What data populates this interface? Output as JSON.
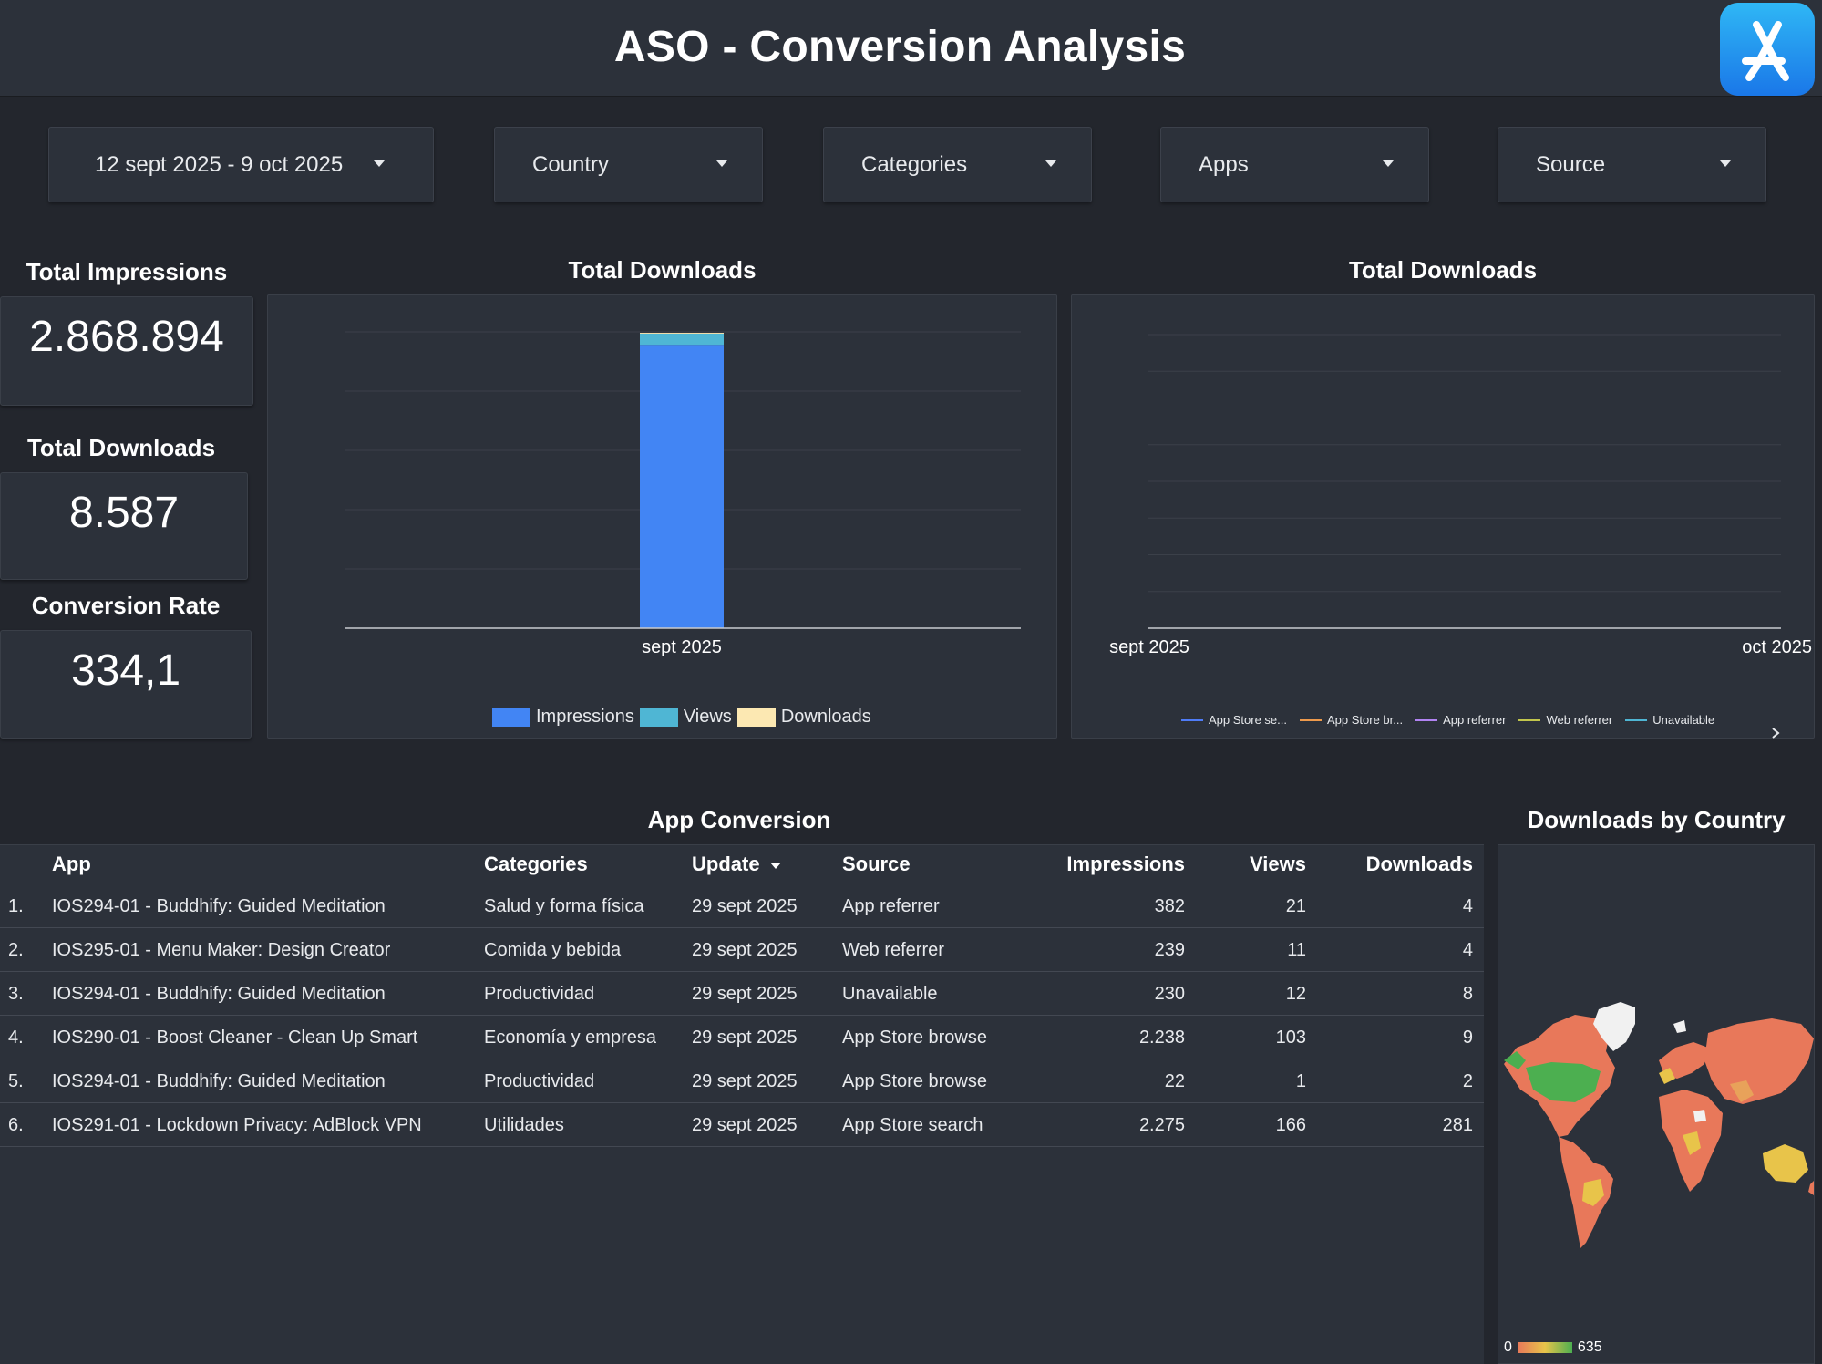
{
  "header": {
    "title": "ASO - Conversion Analysis",
    "logo_icon": "app-store-icon"
  },
  "filters": [
    {
      "label": "12 sept 2025 - 9 oct 2025"
    },
    {
      "label": "Country"
    },
    {
      "label": "Categories"
    },
    {
      "label": "Apps"
    },
    {
      "label": "Source"
    }
  ],
  "kpis": {
    "impressions": {
      "title": "Total Impressions",
      "value": "2.868.894"
    },
    "downloads": {
      "title": "Total Downloads",
      "value": "8.587"
    },
    "conversion": {
      "title": "Conversion Rate",
      "value": "334,1"
    }
  },
  "chart_data": [
    {
      "type": "bar",
      "stacked": true,
      "title": "Total Downloads",
      "categories": [
        "sept 2025"
      ],
      "series": [
        {
          "name": "Impressions",
          "values": [
            2868894
          ],
          "color": "#4285f4"
        },
        {
          "name": "Views",
          "values": [
            113000
          ],
          "color": "#4fb6d4"
        },
        {
          "name": "Downloads",
          "values": [
            8587
          ],
          "color": "#fce8b2"
        }
      ],
      "ylim": [
        0,
        3000000
      ],
      "grid": true,
      "legend": "bottom"
    },
    {
      "type": "line",
      "title": "Total Downloads",
      "x": [
        "sept 2025",
        "oct 2025"
      ],
      "series": [
        {
          "name": "App Store se...",
          "values": [],
          "color": "#4f7cf7"
        },
        {
          "name": "App Store br...",
          "values": [],
          "color": "#ee9a4c"
        },
        {
          "name": "App referrer",
          "values": [],
          "color": "#b183f2"
        },
        {
          "name": "Web referrer",
          "values": [],
          "color": "#c2c64c"
        },
        {
          "name": "Unavailable",
          "values": [],
          "color": "#4fb6d4"
        }
      ],
      "grid": true,
      "legend": "bottom"
    }
  ],
  "table": {
    "title": "App Conversion",
    "columns": [
      "App",
      "Categories",
      "Update",
      "Source",
      "Impressions",
      "Views",
      "Downloads"
    ],
    "sort_icon": "sort-desc-icon",
    "rows": [
      {
        "idx": "1.",
        "app": "IOS294-01 - Buddhify: Guided Meditation",
        "category": "Salud y forma física",
        "update": "29 sept 2025",
        "source": "App referrer",
        "impressions": "382",
        "views": "21",
        "downloads": "4"
      },
      {
        "idx": "2.",
        "app": "IOS295-01 - Menu Maker: Design Creator",
        "category": "Comida y bebida",
        "update": "29 sept 2025",
        "source": "Web referrer",
        "impressions": "239",
        "views": "11",
        "downloads": "4"
      },
      {
        "idx": "3.",
        "app": "IOS294-01 - Buddhify: Guided Meditation",
        "category": "Productividad",
        "update": "29 sept 2025",
        "source": "Unavailable",
        "impressions": "230",
        "views": "12",
        "downloads": "8"
      },
      {
        "idx": "4.",
        "app": "IOS290-01 - Boost Cleaner - Clean Up Smart",
        "category": "Economía y empresa",
        "update": "29 sept 2025",
        "source": "App Store browse",
        "impressions": "2.238",
        "views": "103",
        "downloads": "9"
      },
      {
        "idx": "5.",
        "app": "IOS294-01 - Buddhify: Guided Meditation",
        "category": "Productividad",
        "update": "29 sept 2025",
        "source": "App Store browse",
        "impressions": "22",
        "views": "1",
        "downloads": "2"
      },
      {
        "idx": "6.",
        "app": "IOS291-01 - Lockdown Privacy: AdBlock VPN",
        "category": "Utilidades",
        "update": "29 sept 2025",
        "source": "App Store search",
        "impressions": "2.275",
        "views": "166",
        "downloads": "281"
      }
    ]
  },
  "map": {
    "title": "Downloads by Country",
    "scale_min": "0",
    "scale_max": "635",
    "colors": {
      "low": "#e8785a",
      "mid": "#e8c44a",
      "high": "#4caf50"
    }
  }
}
